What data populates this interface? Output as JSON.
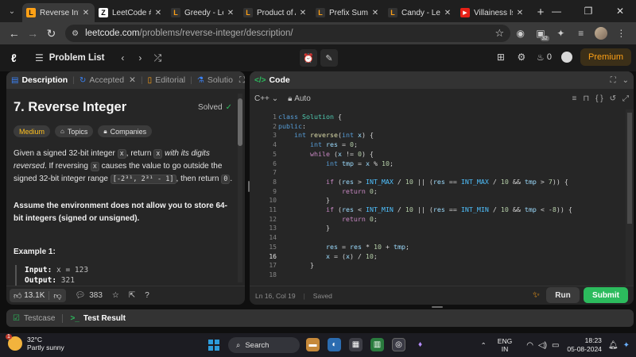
{
  "browser": {
    "tabs": [
      {
        "title": "Reverse Integ",
        "active": true,
        "favicon": "leetcode-icon",
        "fav_glyph": "L"
      },
      {
        "title": "LeetCode #7",
        "active": false,
        "favicon": "z-icon",
        "fav_glyph": "Z"
      },
      {
        "title": "Greedy - Leet",
        "active": false,
        "favicon": "leetcode-icon",
        "fav_glyph": "L"
      },
      {
        "title": "Product of Ar",
        "active": false,
        "favicon": "leetcode-icon",
        "fav_glyph": "L"
      },
      {
        "title": "Prefix Sum -",
        "active": false,
        "favicon": "leetcode-icon",
        "fav_glyph": "L"
      },
      {
        "title": "Candy - Leetc",
        "active": false,
        "favicon": "leetcode-icon",
        "fav_glyph": "L"
      },
      {
        "title": "Villainess Is D",
        "active": false,
        "favicon": "youtube-icon",
        "fav_glyph": "▶"
      }
    ],
    "url_host": "leetcode.com",
    "url_path": "/problems/reverse-integer/description/",
    "extension_badge": "32"
  },
  "header": {
    "problem_list_label": "Problem List",
    "streak_count": "0",
    "premium_label": "Premium"
  },
  "left_panel": {
    "tabs": [
      {
        "label": "Description",
        "icon": "description-icon",
        "glyph": "▤",
        "active": true
      },
      {
        "label": "Accepted",
        "icon": "accepted-icon",
        "glyph": "↻",
        "active": false,
        "closable": true
      },
      {
        "label": "Editorial",
        "icon": "editorial-icon",
        "glyph": "▯",
        "active": false
      },
      {
        "label": "Solutio",
        "icon": "solutions-icon",
        "glyph": "⚗",
        "active": false
      }
    ],
    "title": "7. Reverse Integer",
    "status": "Solved",
    "difficulty": "Medium",
    "topics_label": "Topics",
    "companies_label": "Companies",
    "desc_1": "Given a signed 32-bit integer ",
    "desc_x": "x",
    "desc_2": ", return ",
    "desc_x2": "x",
    "desc_italic": " with its digits reversed",
    "desc_3": ". If reversing ",
    "desc_x3": "x",
    "desc_4": " causes the value to go outside the signed 32-bit integer range ",
    "desc_range": "[-2³¹, 2³¹ - 1]",
    "desc_5": ", then return ",
    "desc_zero": "0",
    "desc_6": ".",
    "assume_text": "Assume the environment does not allow you to store 64-bit integers (signed or unsigned).",
    "example_heading": "Example 1:",
    "example_input_label": "Input:",
    "example_input_value": " x = 123",
    "example_output_label": "Output:",
    "example_output_value": " 321",
    "likes": "13.1K",
    "comments": "383"
  },
  "right_panel": {
    "title": "Code",
    "language": "C++",
    "auto_label": "Auto",
    "cursor_pos": "Ln 16, Col 19",
    "save_status": "Saved",
    "run_label": "Run",
    "submit_label": "Submit",
    "code_lines": [
      "class Solution {",
      "public:",
      "    int reverse(int x) {",
      "        int res = 0;",
      "        while (x != 0) {",
      "            int tmp = x % 10;",
      "",
      "            if (res > INT_MAX / 10 || (res == INT_MAX / 10 && tmp > 7)) {",
      "                return 0;",
      "            }",
      "            if (res < INT_MIN / 10 || (res == INT_MIN / 10 && tmp < -8)) {",
      "                return 0;",
      "            }",
      "",
      "            res = res * 10 + tmp;",
      "            x = (x) / 10;",
      "        }",
      ""
    ],
    "line_numbers": [
      "1",
      "2",
      "3",
      "4",
      "5",
      "6",
      "7",
      "8",
      "9",
      "10",
      "11",
      "12",
      "13",
      "14",
      "15",
      "16",
      "17",
      "18"
    ],
    "current_line": "16"
  },
  "bottom": {
    "testcase_label": "Testcase",
    "result_label": "Test Result"
  },
  "taskbar": {
    "temperature": "32°C",
    "weather": "Partly sunny",
    "weather_badge": "1",
    "search_label": "Search",
    "lang_1": "ENG",
    "lang_2": "IN",
    "time": "18:23",
    "date": "05-08-2024"
  },
  "colors": {
    "accent_orange": "#ffa116",
    "submit_green": "#2cbb5d",
    "medium_yellow": "#ffc01e"
  }
}
